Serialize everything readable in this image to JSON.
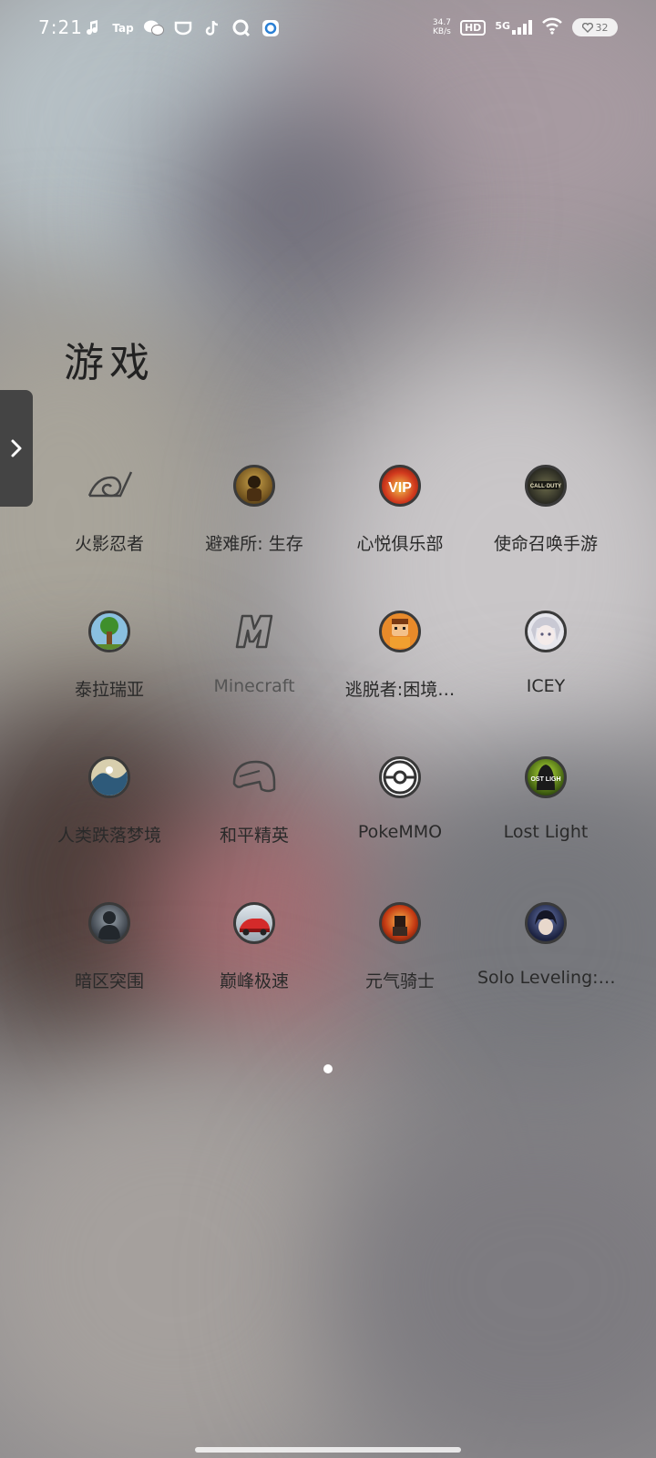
{
  "status_bar": {
    "time": "7:21",
    "notification_icons": [
      "music-icon",
      "tap-icon",
      "wechat-icon",
      "cup-icon",
      "tiktok-icon",
      "search-app-icon",
      "shield-app-icon"
    ],
    "tap_label": "Tap",
    "net_speed_value": "34.7",
    "net_speed_unit": "KB/s",
    "hd_label": "HD",
    "network_label": "5G",
    "battery_level": "32"
  },
  "folder": {
    "title": "游戏"
  },
  "apps": [
    {
      "label": "火影忍者",
      "icon": "naruto-leaf-icon"
    },
    {
      "label": "避难所: 生存",
      "icon": "shelter-survivor-icon"
    },
    {
      "label": "心悦俱乐部",
      "icon": "xinyue-club-icon"
    },
    {
      "label": "使命召唤手游",
      "icon": "call-of-duty-icon"
    },
    {
      "label": "泰拉瑞亚",
      "icon": "terraria-tree-icon"
    },
    {
      "label": "Minecraft",
      "icon": "minecraft-m-icon"
    },
    {
      "label": "逃脱者:困境…",
      "icon": "escapists-icon"
    },
    {
      "label": "ICEY",
      "icon": "icey-face-icon"
    },
    {
      "label": "人类跌落梦境",
      "icon": "human-fall-flat-icon"
    },
    {
      "label": "和平精英",
      "icon": "peace-elite-helmet-icon"
    },
    {
      "label": "PokeMMO",
      "icon": "pokeball-icon"
    },
    {
      "label": "Lost Light",
      "icon": "lost-light-icon"
    },
    {
      "label": "暗区突围",
      "icon": "arena-breakout-icon"
    },
    {
      "label": "巅峰极速",
      "icon": "racing-master-icon"
    },
    {
      "label": "元气骑士",
      "icon": "soul-knight-icon"
    },
    {
      "label": "Solo Leveling:…",
      "icon": "solo-leveling-icon"
    }
  ],
  "pager": {
    "current_page": 1,
    "total_pages": 1
  }
}
